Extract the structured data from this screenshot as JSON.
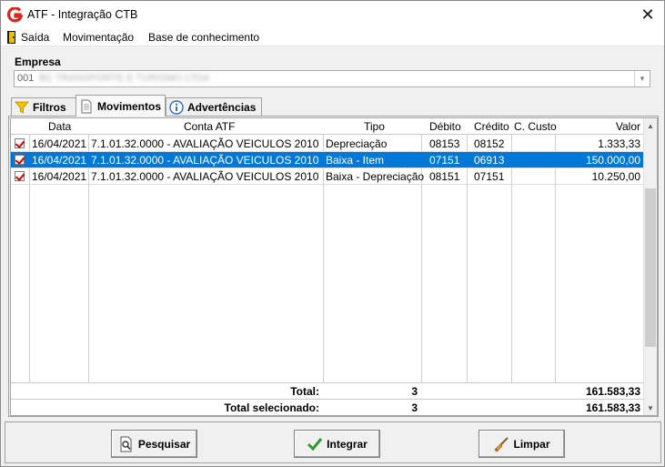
{
  "window": {
    "title": "ATF - Integração CTB",
    "close_glyph": "✕"
  },
  "menu": [
    {
      "label": "Saída"
    },
    {
      "label": "Movimentação"
    },
    {
      "label": "Base de conhecimento"
    }
  ],
  "empresa": {
    "label": "Empresa",
    "code": "001",
    "name": "BC TRANSPORTE E TURISMO LTDA"
  },
  "tabs": [
    {
      "label": "Filtros",
      "icon": "funnel-icon"
    },
    {
      "label": "Movimentos",
      "icon": "document-icon",
      "active": true
    },
    {
      "label": "Advertências",
      "icon": "info-icon"
    }
  ],
  "grid": {
    "columns": [
      "",
      "Data",
      "Conta ATF",
      "Tipo",
      "Débito",
      "Crédito",
      "C. Custo",
      "Valor"
    ],
    "rows": [
      {
        "checked": true,
        "data": "16/04/2021",
        "conta": "7.1.01.32.0000 - AVALIAÇÃO VEICULOS 2010",
        "tipo": "Depreciação",
        "debito": "08153",
        "credito": "08152",
        "custo": "",
        "valor": "1.333,33",
        "selected": false
      },
      {
        "checked": true,
        "data": "16/04/2021",
        "conta": "7.1.01.32.0000 - AVALIAÇÃO VEICULOS 2010",
        "tipo": "Baixa - Item",
        "debito": "07151",
        "credito": "06913",
        "custo": "",
        "valor": "150.000,00",
        "selected": true
      },
      {
        "checked": true,
        "data": "16/04/2021",
        "conta": "7.1.01.32.0000 - AVALIAÇÃO VEICULOS 2010",
        "tipo": "Baixa - Depreciação",
        "debito": "08151",
        "credito": "07151",
        "custo": "",
        "valor": "10.250,00",
        "selected": false
      }
    ],
    "totals": [
      {
        "label": "Total:",
        "count": "3",
        "valor": "161.583,33"
      },
      {
        "label": "Total selecionado:",
        "count": "3",
        "valor": "161.583,33"
      }
    ]
  },
  "buttons": [
    {
      "label": "Pesquisar",
      "icon": "magnifier-document-icon"
    },
    {
      "label": "Integrar",
      "icon": "checkmark-icon"
    },
    {
      "label": "Limpar",
      "icon": "broom-icon"
    }
  ],
  "colors": {
    "selection": "#0078d7",
    "check": "#cc0000",
    "app_icon": "#d9251c"
  }
}
